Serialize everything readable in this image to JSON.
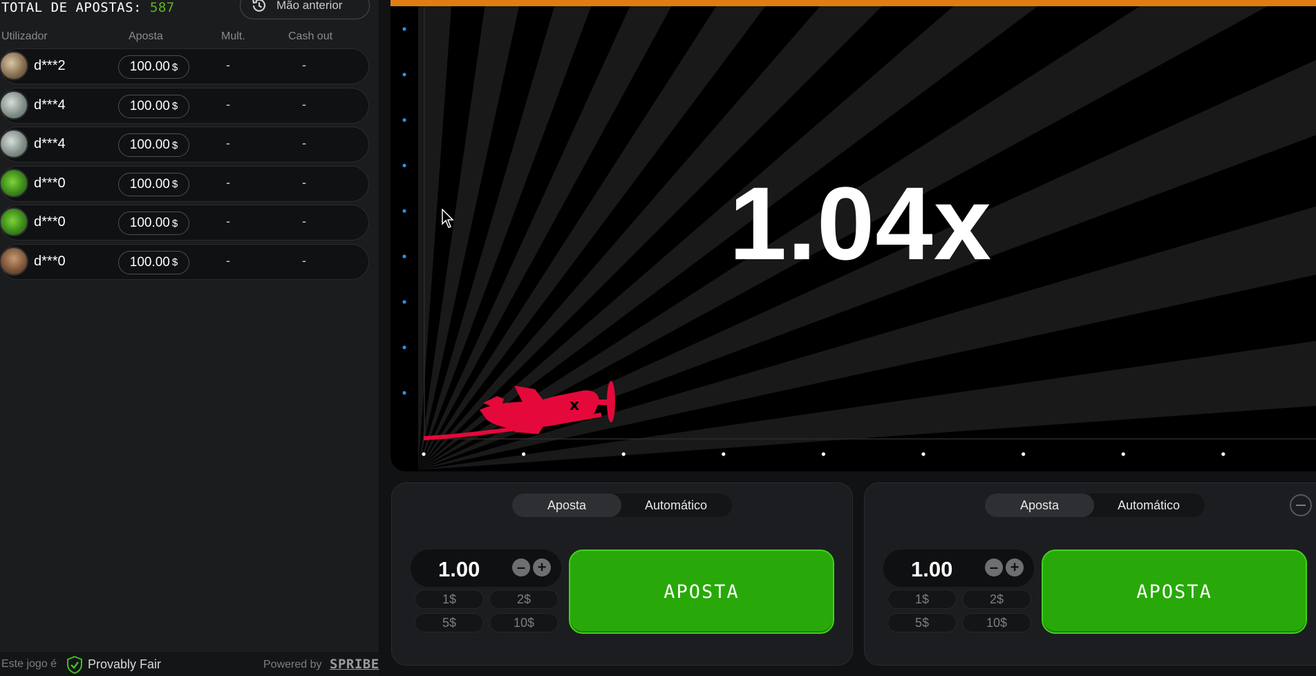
{
  "left": {
    "total_label": "TOTAL DE APOSTAS:",
    "total_count": "587",
    "prev_button": "Mão anterior",
    "columns": {
      "user": "Utilizador",
      "bet": "Aposta",
      "mult": "Mult.",
      "cash": "Cash out"
    },
    "rows": [
      {
        "user": "d***2",
        "bet": "100.00",
        "currency": "$",
        "mult": "-",
        "cash": "-"
      },
      {
        "user": "d***4",
        "bet": "100.00",
        "currency": "$",
        "mult": "-",
        "cash": "-"
      },
      {
        "user": "d***4",
        "bet": "100.00",
        "currency": "$",
        "mult": "-",
        "cash": "-"
      },
      {
        "user": "d***0",
        "bet": "100.00",
        "currency": "$",
        "mult": "-",
        "cash": "-"
      },
      {
        "user": "d***0",
        "bet": "100.00",
        "currency": "$",
        "mult": "-",
        "cash": "-"
      },
      {
        "user": "d***0",
        "bet": "100.00",
        "currency": "$",
        "mult": "-",
        "cash": "-"
      }
    ],
    "avatar_types": [
      "mixed",
      "money",
      "money",
      "clover",
      "clover",
      "dog"
    ]
  },
  "footer": {
    "game_is": "Este jogo é",
    "provably_fair": "Provably Fair",
    "powered_by": "Powered by",
    "brand": "SPRIBE"
  },
  "game": {
    "multiplier": "1.04x",
    "plane_color": "#e4093a",
    "accent_color": "#e07d12"
  },
  "panels": [
    {
      "tab_bet": "Aposta",
      "tab_auto": "Automático",
      "amount": "1.00",
      "chips": [
        "1$",
        "2$",
        "5$",
        "10$"
      ],
      "button": "APOSTA"
    },
    {
      "tab_bet": "Aposta",
      "tab_auto": "Automático",
      "amount": "1.00",
      "chips": [
        "1$",
        "2$",
        "5$",
        "10$"
      ],
      "button": "APOSTA"
    }
  ],
  "colors": {
    "bet_button": "#28a909",
    "count_green": "#5fb521"
  }
}
